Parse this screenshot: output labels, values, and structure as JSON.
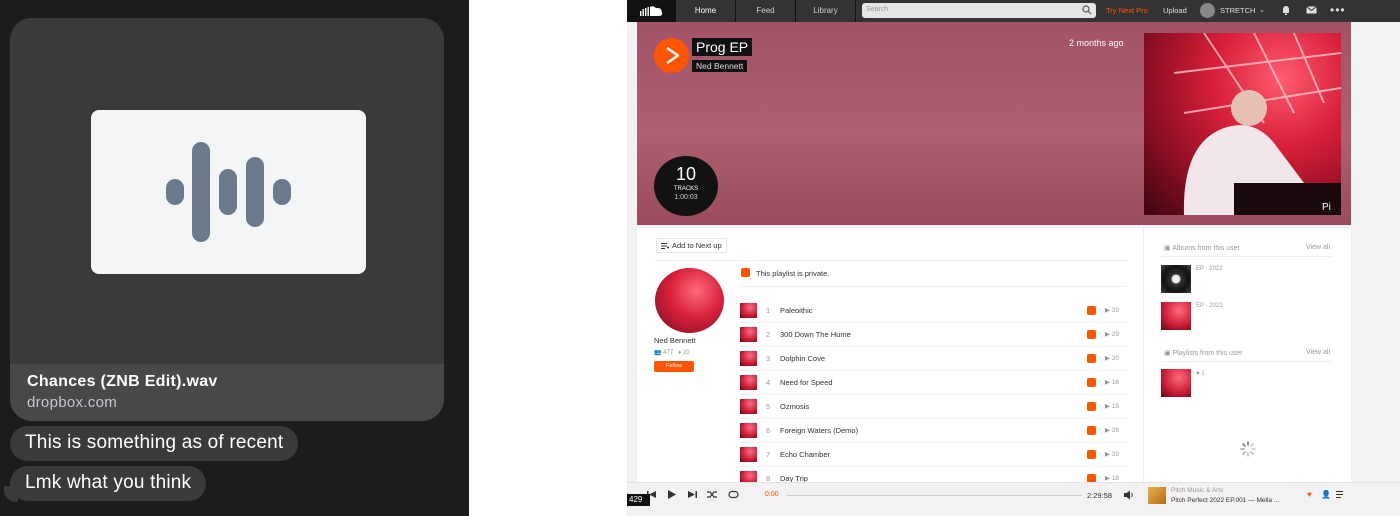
{
  "messages": {
    "attachment": {
      "filename": "Chances (ZNB Edit).wav",
      "host": "dropbox.com",
      "icon": "audio-waveform-icon"
    },
    "bubbles": [
      "This is something as of recent",
      "Lmk what you think"
    ]
  },
  "soundcloud": {
    "nav": {
      "home": "Home",
      "feed": "Feed",
      "library": "Library",
      "search_placeholder": "Search",
      "try_pro": "Try Next Pro",
      "upload": "Upload",
      "username": "STRETCH",
      "accent": "#ff5500"
    },
    "playlist": {
      "title": "Prog EP",
      "artist": "Ned Bennett",
      "posted": "2 months ago",
      "track_count": "10",
      "tracks_label": "TRACKS",
      "duration": "1:00:03",
      "add_next_up": "Add to Next up",
      "private_note": "This playlist is private."
    },
    "artist": {
      "name": "Ned Bennett",
      "followers": "477",
      "tracks": "20",
      "follow_label": "Follow"
    },
    "tracks": [
      {
        "num": "1",
        "title": "Paleoithic",
        "plays": "33"
      },
      {
        "num": "2",
        "title": "300 Down The Hume",
        "plays": "29"
      },
      {
        "num": "3",
        "title": "Dolphin Cove",
        "plays": "20"
      },
      {
        "num": "4",
        "title": "Need for Speed",
        "plays": "16"
      },
      {
        "num": "5",
        "title": "Ozmosis",
        "plays": "15"
      },
      {
        "num": "6",
        "title": "Foreign Waters (Demo)",
        "plays": "26"
      },
      {
        "num": "7",
        "title": "Echo Chamber",
        "plays": "33"
      },
      {
        "num": "8",
        "title": "Day Trip",
        "plays": "18"
      }
    ],
    "sidebar": {
      "albums_heading": "Albums from this user",
      "view_all": "View all",
      "albums": [
        "EP · 2022",
        "EP · 2022"
      ],
      "playlists_heading": "Playlists from this user",
      "playlist_likes": "1"
    },
    "player": {
      "current_time": "0:00",
      "total_time": "2:29:58",
      "now_playing_artist": "Pitch Music & Arts",
      "now_playing_title": "Pitch Perfect 2022 EP.001 — Mella ...",
      "counter": "429"
    }
  }
}
